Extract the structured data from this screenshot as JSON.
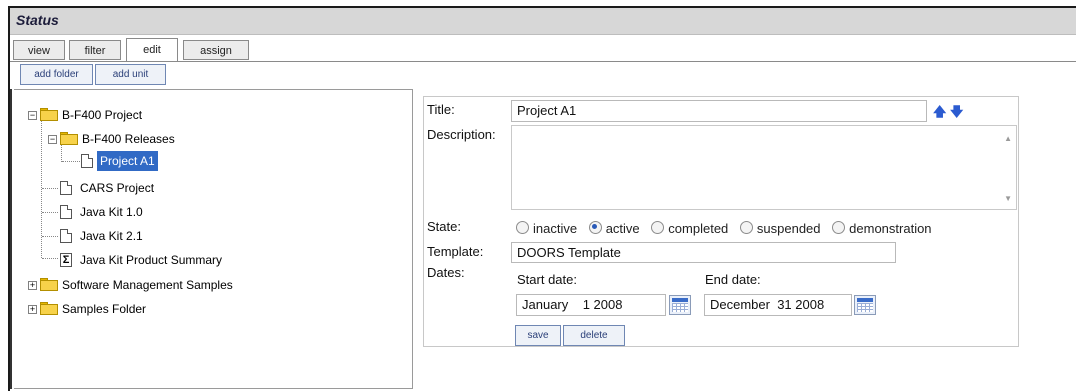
{
  "window": {
    "title": "Status"
  },
  "tabs": [
    {
      "label": "view",
      "active": false
    },
    {
      "label": "filter",
      "active": false
    },
    {
      "label": "edit",
      "active": true
    },
    {
      "label": "assign",
      "active": false
    }
  ],
  "toolbar": {
    "add_folder": "add folder",
    "add_unit": "add unit"
  },
  "tree": {
    "items": [
      {
        "label": "B-F400 Project",
        "type": "folder",
        "expanded": true
      },
      {
        "label": "B-F400 Releases",
        "type": "folder",
        "expanded": true
      },
      {
        "label": "Project A1",
        "type": "document",
        "selected": true
      },
      {
        "label": "CARS Project",
        "type": "document"
      },
      {
        "label": "Java Kit 1.0",
        "type": "document"
      },
      {
        "label": "Java Kit 2.1",
        "type": "document"
      },
      {
        "label": "Java Kit Product Summary",
        "type": "summary"
      },
      {
        "label": "Software Management Samples",
        "type": "folder",
        "expanded": false
      },
      {
        "label": "Samples Folder",
        "type": "folder",
        "expanded": false
      }
    ]
  },
  "form": {
    "title_label": "Title:",
    "title_value": "Project A1",
    "description_label": "Description:",
    "description_value": "",
    "state_label": "State:",
    "state_options": [
      {
        "label": "inactive",
        "checked": false
      },
      {
        "label": "active",
        "checked": true
      },
      {
        "label": "completed",
        "checked": false
      },
      {
        "label": "suspended",
        "checked": false
      },
      {
        "label": "demonstration",
        "checked": false
      }
    ],
    "template_label": "Template:",
    "template_value": "DOORS Template",
    "dates_label": "Dates:",
    "start_date_label": "Start date:",
    "start_date_value": "January    1 2008",
    "end_date_label": "End date:",
    "end_date_value": "December  31 2008",
    "save_label": "save",
    "delete_label": "delete"
  },
  "colors": {
    "selection": "#316ac5",
    "accent": "#2b5bd0",
    "folder": "#f7d24a"
  }
}
